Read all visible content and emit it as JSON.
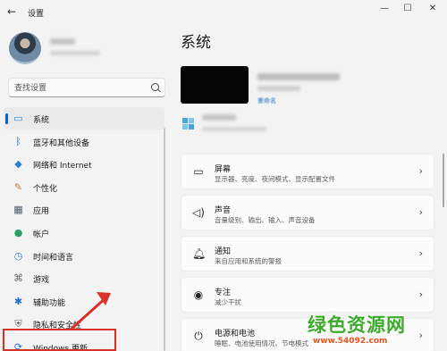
{
  "window": {
    "title": "设置",
    "minimize_glyph": "—",
    "maximize_glyph": "☐",
    "close_glyph": "✕",
    "back_glyph": "←"
  },
  "search": {
    "placeholder": "查找设置"
  },
  "sidebar": {
    "items": [
      {
        "label": "系统",
        "icon": "monitor-icon",
        "glyph": "▭",
        "color": "#2f8bd8",
        "active": true
      },
      {
        "label": "蓝牙和其他设备",
        "icon": "bluetooth-icon",
        "glyph": "ᛒ",
        "color": "#1f6fd1"
      },
      {
        "label": "网络和 Internet",
        "icon": "wifi-icon",
        "glyph": "◆",
        "color": "#2a7fd6"
      },
      {
        "label": "个性化",
        "icon": "brush-icon",
        "glyph": "✎",
        "color": "#d07a2c"
      },
      {
        "label": "应用",
        "icon": "apps-icon",
        "glyph": "▦",
        "color": "#4d5b6b"
      },
      {
        "label": "帐户",
        "icon": "account-icon",
        "glyph": "●",
        "color": "#27a061"
      },
      {
        "label": "时间和语言",
        "icon": "clock-globe-icon",
        "glyph": "◷",
        "color": "#2a7fd6"
      },
      {
        "label": "游戏",
        "icon": "gamepad-icon",
        "glyph": "⌘",
        "color": "#6b6b6b"
      },
      {
        "label": "辅助功能",
        "icon": "accessibility-icon",
        "glyph": "✱",
        "color": "#1f6fd1"
      },
      {
        "label": "隐私和安全性",
        "icon": "shield-icon",
        "glyph": "⛨",
        "color": "#6b6b6b"
      },
      {
        "label": "Windows 更新",
        "icon": "windows-update-icon",
        "glyph": "⟳",
        "color": "#1f6fd1",
        "highlighted": true
      }
    ]
  },
  "main": {
    "title": "系统",
    "rename": "重命名",
    "cards": [
      {
        "title": "屏幕",
        "subtitle": "显示器、亮度、夜间模式、显示配置文件",
        "icon": "display-icon",
        "glyph": "▭"
      },
      {
        "title": "声音",
        "subtitle": "音量级别、输出、输入、声音设备",
        "icon": "speaker-icon",
        "glyph": "◁)"
      },
      {
        "title": "通知",
        "subtitle": "来自应用和系统的警报",
        "icon": "bell-icon",
        "glyph": "🔔︎"
      },
      {
        "title": "专注",
        "subtitle": "减少干扰",
        "icon": "focus-icon",
        "glyph": "◉"
      },
      {
        "title": "电源和电池",
        "subtitle": "睡眠、电池使用情况、节电模式",
        "icon": "power-icon",
        "glyph": "⏻"
      }
    ],
    "chevron": "›"
  },
  "watermark": {
    "title": "绿色资源网",
    "url": "www.54092.com"
  },
  "colors": {
    "accent": "#0067c0",
    "highlight_box": "#d9302a",
    "watermark_green": "#3cab2c",
    "watermark_orange": "#e8541c"
  }
}
